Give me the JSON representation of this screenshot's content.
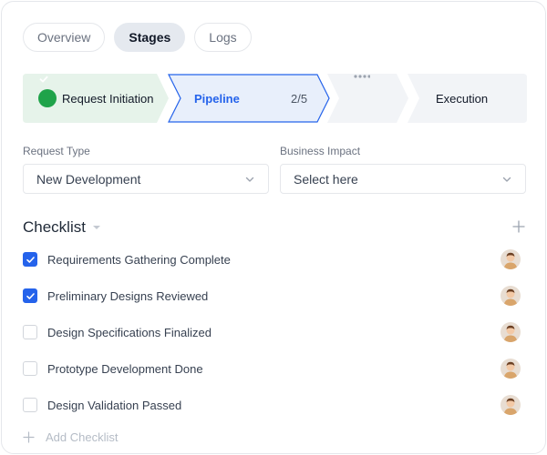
{
  "tabs": [
    {
      "label": "Overview",
      "active": false
    },
    {
      "label": "Stages",
      "active": true
    },
    {
      "label": "Logs",
      "active": false
    }
  ],
  "stepper": {
    "steps": [
      {
        "label": "Request Initiation",
        "status": "complete",
        "color": "#e6f3ea"
      },
      {
        "label": "Pipeline",
        "count": "2/5",
        "status": "current",
        "color": "#e8effb",
        "accent": "#2563eb"
      },
      {
        "label": "",
        "status": "more",
        "color": "#f2f4f7"
      },
      {
        "label": "Execution",
        "status": "pending",
        "color": "#f2f4f7"
      }
    ]
  },
  "form": {
    "request_type": {
      "label": "Request Type",
      "value": "New Development"
    },
    "business_impact": {
      "label": "Business Impact",
      "placeholder": "Select here"
    }
  },
  "checklist": {
    "title": "Checklist",
    "items": [
      {
        "text": "Requirements Gathering Complete",
        "checked": true
      },
      {
        "text": "Preliminary Designs Reviewed",
        "checked": true
      },
      {
        "text": "Design Specifications Finalized",
        "checked": false
      },
      {
        "text": "Prototype Development Done",
        "checked": false
      },
      {
        "text": "Design Validation Passed",
        "checked": false
      }
    ],
    "add_label": "Add Checklist"
  },
  "icons": {
    "check": "check-icon",
    "chevron": "chevron-down-icon",
    "caret": "caret-down-icon",
    "plus": "plus-icon",
    "avatar": "avatar"
  }
}
